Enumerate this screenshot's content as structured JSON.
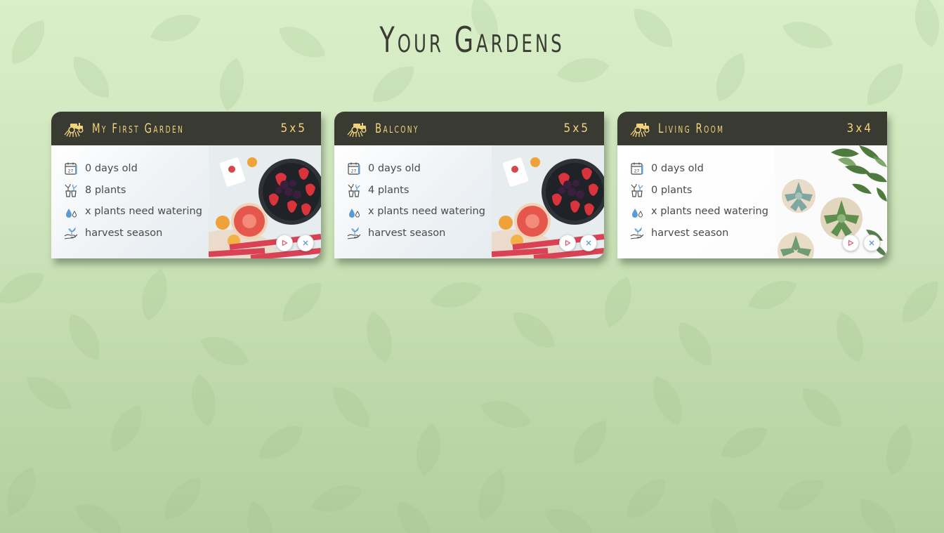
{
  "page": {
    "title": "Your Gardens"
  },
  "colors": {
    "header_bg": "#393b33",
    "header_text": "#f2d27a",
    "page_bg": "#cfe6bd",
    "stat_text": "#4a4a4a",
    "water_icon": "#5b9bd5",
    "play_icon": "#e0546e",
    "close_icon": "#5b9bd5"
  },
  "gardens": [
    {
      "name": "My First Garden",
      "size": "5x5",
      "age": "0 days old",
      "plants": "8 plants",
      "watering": "x plants need watering",
      "season": "harvest season",
      "photo": "fruit-bowl-photo",
      "icon": "tractor-icon"
    },
    {
      "name": "Balcony",
      "size": "5x5",
      "age": "0 days old",
      "plants": "4 plants",
      "watering": "x plants need watering",
      "season": "harvest season",
      "photo": "fruit-bowl-photo",
      "icon": "tractor-icon"
    },
    {
      "name": "Living Room",
      "size": "3x4",
      "age": "0 days old",
      "plants": "0 plants",
      "watering": "x plants need watering",
      "season": "harvest season",
      "photo": "succulents-photo",
      "icon": "tractor-icon"
    }
  ],
  "stat_icons": [
    "calendar-icon",
    "plant-pots-icon",
    "water-drops-icon",
    "hand-sprout-icon"
  ],
  "actions": [
    "play-icon",
    "close-icon"
  ]
}
